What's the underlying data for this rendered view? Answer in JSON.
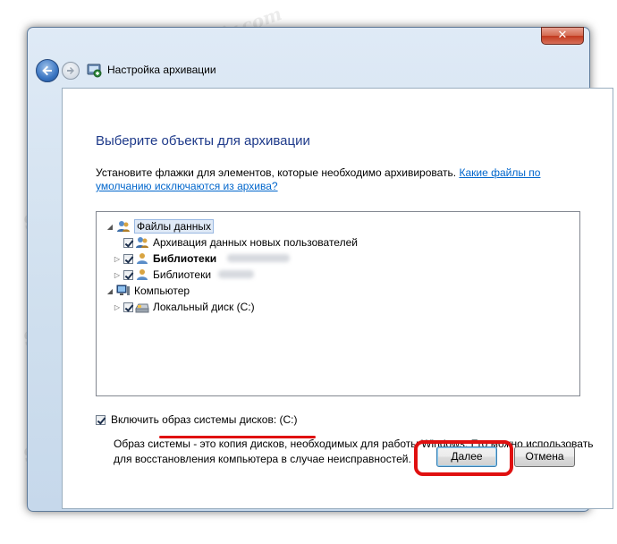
{
  "window": {
    "title": "Настройка архивации",
    "close_glyph": "✕",
    "back_icon": "back-arrow-icon",
    "forward_icon": "forward-arrow-icon",
    "title_icon": "backup-icon"
  },
  "main": {
    "heading": "Выберите объекты для архивации",
    "instruction": "Установите флажки для элементов, которые необходимо архивировать.",
    "help_link": "Какие файлы по умолчанию исключаются из архива?"
  },
  "tree": [
    {
      "label": "Файлы данных",
      "checked": false,
      "expander": "◢",
      "icon": "users-icon"
    },
    {
      "label": "Архивация данных новых пользователей",
      "checked": true,
      "icon": "users-icon"
    },
    {
      "label": "Библиотеки",
      "checked": true,
      "expander": "▷",
      "bold": true,
      "icon": "user-icon"
    },
    {
      "label": "Библиотеки",
      "checked": true,
      "expander": "▷",
      "icon": "user-icon"
    },
    {
      "label": "Компьютер",
      "checked": false,
      "expander": "◢",
      "icon": "computer-icon"
    },
    {
      "label": "Локальный диск (C:)",
      "checked": true,
      "expander": "▷",
      "icon": "drive-icon"
    }
  ],
  "system_image": {
    "label": "Включить образ системы дисков: (C:)",
    "checked": true,
    "description": "Образ системы - это копия дисков, необходимых для работы Windows. Его можно использовать для восстановления компьютера в случае неисправностей."
  },
  "buttons": {
    "next": "Далее",
    "cancel": "Отмена"
  },
  "watermark": "Soringpcrepair.com",
  "colors": {
    "heading": "#1e3a8a",
    "link": "#0066cc",
    "highlight": "#e01010"
  }
}
